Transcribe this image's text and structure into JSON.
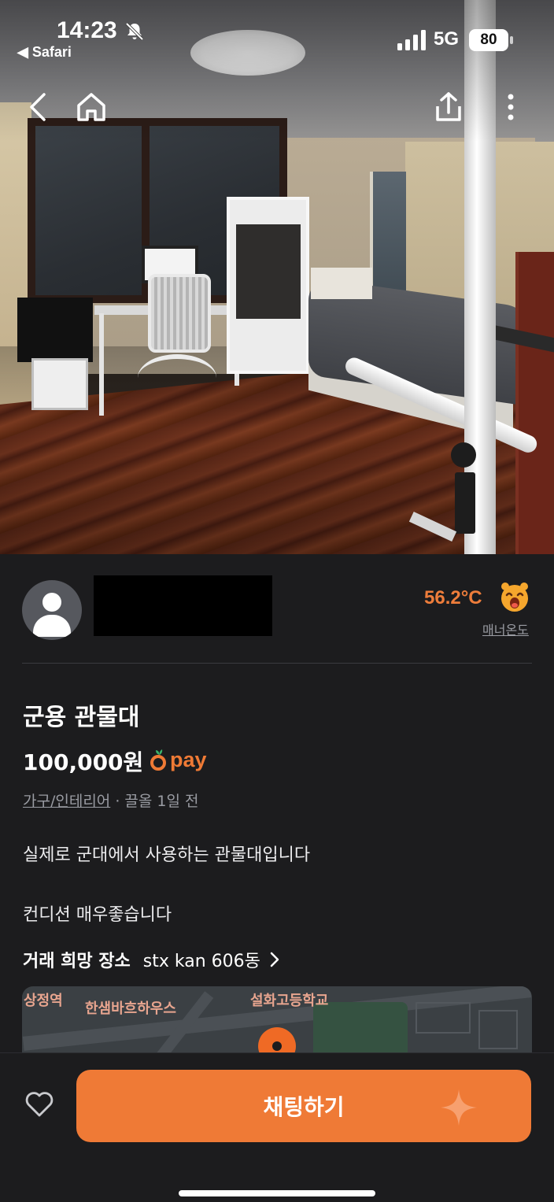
{
  "status_bar": {
    "time": "14:23",
    "back_app": "◀ Safari",
    "network": "5G",
    "battery": "80"
  },
  "nav": {
    "back_icon": "chevron-left-icon",
    "home_icon": "home-icon",
    "share_icon": "share-icon",
    "more_icon": "more-vertical-icon"
  },
  "seller": {
    "manner_temp": "56.2°C",
    "manner_label": "매너온도"
  },
  "product": {
    "title": "군용 관물대",
    "price": "100,000원",
    "pay_label": "pay",
    "category": "가구/인테리어",
    "bump_info": " · 끌올 1일 전",
    "description": "실제로 군대에서 사용하는 관물대입니다\n\n컨디션 매우좋습니다"
  },
  "trade_place": {
    "label": "거래 희망 장소",
    "value": "stx kan 606동"
  },
  "map": {
    "labels": [
      "상정역",
      "한샘바흐하우스",
      "설화고등학교"
    ]
  },
  "bottom_bar": {
    "chat_label": "채팅하기"
  },
  "colors": {
    "accent": "#EF7A36",
    "background": "#1C1C1E",
    "temp": "#EE7D3B"
  }
}
